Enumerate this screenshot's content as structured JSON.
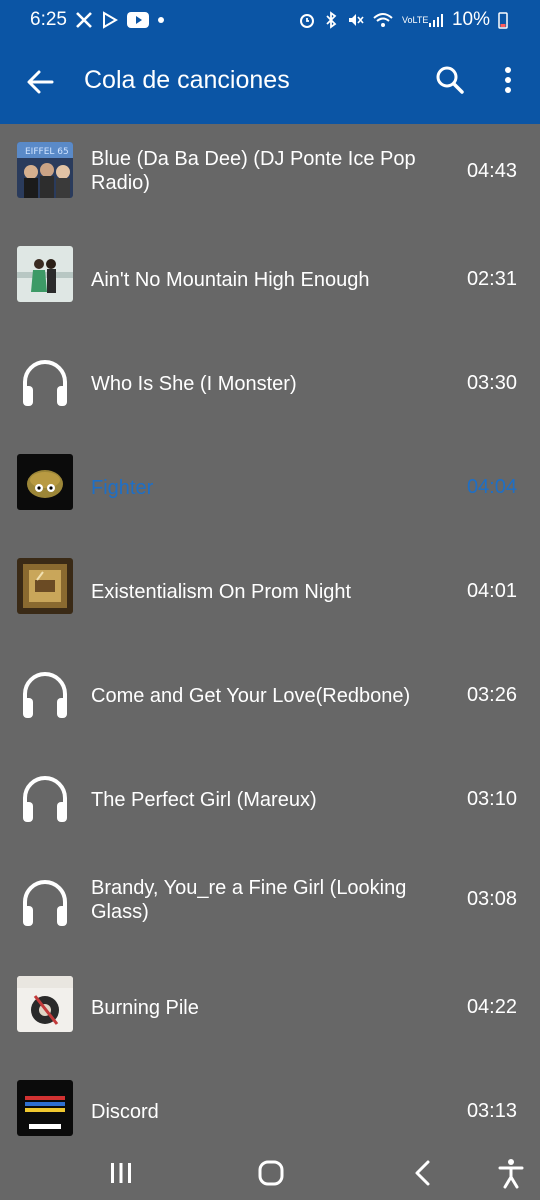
{
  "status": {
    "time": "6:25",
    "battery": "10%",
    "network": "VoLTE"
  },
  "appbar": {
    "title": "Cola de canciones"
  },
  "queue": [
    {
      "title": "Blue (Da Ba Dee) (DJ Ponte Ice Pop Radio)",
      "duration": "04:43",
      "art": "album-eiffel65-icon",
      "playing": false
    },
    {
      "title": "Ain't No Mountain High Enough",
      "duration": "02:31",
      "art": "album-couple-icon",
      "playing": false
    },
    {
      "title": "Who Is She (I Monster)",
      "duration": "03:30",
      "art": "headphones-icon",
      "playing": false
    },
    {
      "title": "Fighter",
      "duration": "04:04",
      "art": "album-fighter-icon",
      "playing": true
    },
    {
      "title": "Existentialism On Prom Night",
      "duration": "04:01",
      "art": "album-frame-icon",
      "playing": false
    },
    {
      "title": "Come and Get Your Love(Redbone)",
      "duration": "03:26",
      "art": "headphones-icon",
      "playing": false
    },
    {
      "title": "The Perfect Girl (Mareux)",
      "duration": "03:10",
      "art": "headphones-icon",
      "playing": false
    },
    {
      "title": "Brandy, You_re a Fine Girl (Looking Glass)",
      "duration": "03:08",
      "art": "headphones-icon",
      "playing": false
    },
    {
      "title": "Burning Pile",
      "duration": "04:22",
      "art": "album-burning-pile-icon",
      "playing": false
    },
    {
      "title": "Discord",
      "duration": "03:13",
      "art": "album-discord-icon",
      "playing": false
    }
  ],
  "colors": {
    "header": "#0b55a5",
    "background": "#676767",
    "playing_accent": "#1e6fc6"
  },
  "navigation": {
    "buttons": [
      "recents-icon",
      "home-icon",
      "back-icon",
      "accessibility-icon"
    ]
  }
}
